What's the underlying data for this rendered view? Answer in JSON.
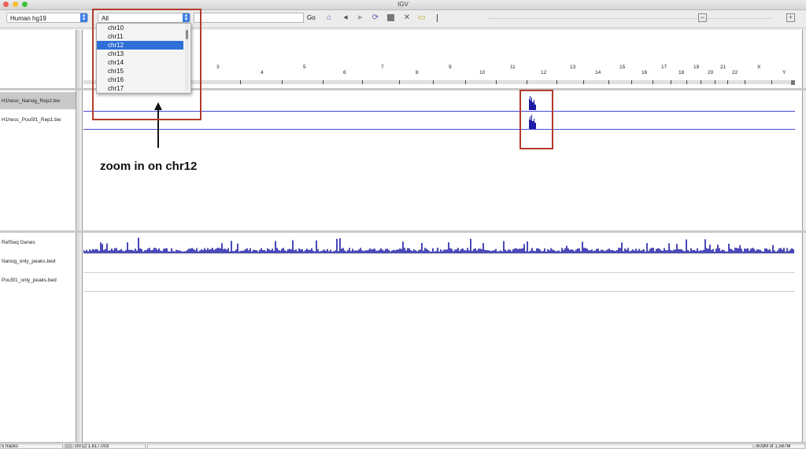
{
  "window": {
    "title": "IGV"
  },
  "toolbar": {
    "genome": "Human hg19",
    "locus": "All",
    "locus_input": "",
    "go_label": "Go",
    "icons": [
      "home-icon",
      "back-icon",
      "forward-icon",
      "refresh-icon",
      "roi-icon",
      "resize-icon",
      "popup-text-icon",
      "ruler-line-icon",
      "zoom-out-icon",
      "zoom-in-icon"
    ]
  },
  "dropdown": {
    "items": [
      "chr10",
      "chr11",
      "chr12",
      "chr13",
      "chr14",
      "chr15",
      "chr16",
      "chr17"
    ],
    "selected": "chr12"
  },
  "ruler": {
    "labels": [
      "3",
      "4",
      "5",
      "6",
      "7",
      "8",
      "9",
      "10",
      "11",
      "12",
      "13",
      "14",
      "15",
      "16",
      "17",
      "18",
      "19",
      "20",
      "21",
      "22",
      "X",
      "Y"
    ]
  },
  "data_tracks": [
    "H1hesc_Nanog_Rep2.bw",
    "H1hesc_Pou5f1_Rep1.bw"
  ],
  "feature_tracks": [
    "RefSeq Genes",
    "Nanog_only_peaks.bed",
    "Pou5f1_only_peaks.bed"
  ],
  "annotation": "zoom in on chr12",
  "status": {
    "tracks": "5 tracks",
    "position": "chr12:1,617,003",
    "memory": "603M of 1,587M"
  },
  "colors": {
    "track": "#1c1ca6",
    "highlight": "#b33a2a",
    "selection": "#2f6fd8"
  }
}
